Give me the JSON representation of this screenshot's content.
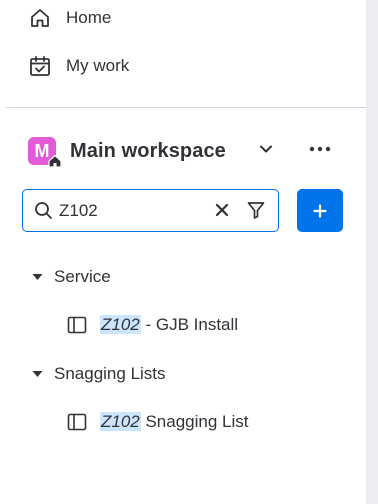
{
  "colors": {
    "accent": "#0073ea",
    "workspace_avatar": "#e35bd8",
    "highlight": "#cce5ff"
  },
  "nav": [
    {
      "label": "Home",
      "icon": "home-icon"
    },
    {
      "label": "My work",
      "icon": "calendar-check-icon"
    }
  ],
  "workspace": {
    "avatar_letter": "M",
    "name": "Main workspace",
    "chevron_icon": "chevron-down-icon",
    "more_icon": "more-icon"
  },
  "search": {
    "value": "Z102",
    "icons": [
      "search-icon",
      "close-icon",
      "filter-icon"
    ]
  },
  "add_button": {
    "icon": "plus-icon"
  },
  "tree": [
    {
      "folder": "Service",
      "boards": [
        {
          "match": "Z102",
          "rest": " - GJB Install"
        }
      ]
    },
    {
      "folder": "Snagging Lists",
      "boards": [
        {
          "match": "Z102",
          "rest": " Snagging List"
        }
      ]
    }
  ]
}
